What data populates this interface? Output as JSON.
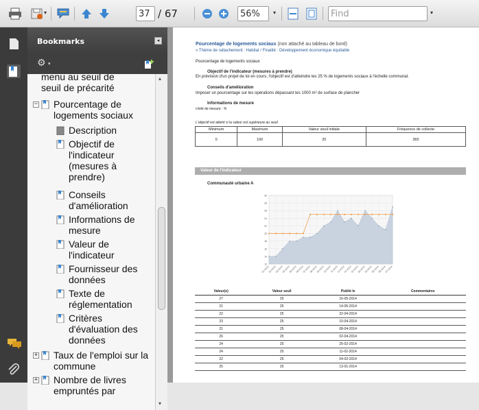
{
  "toolbar": {
    "page_current": "37",
    "page_total": "/ 67",
    "zoom": "56%",
    "find_placeholder": "Find"
  },
  "bookmarks_panel": {
    "title": "Bookmarks",
    "items": [
      {
        "label": "seuil de précarité"
      },
      {
        "label": "Pourcentage de logements sociaux"
      },
      {
        "label": "Description"
      },
      {
        "label": "Objectif de l'indicateur (mesures à prendre)"
      },
      {
        "label": "Conseils d'amélioration"
      },
      {
        "label": "Informations de mesure"
      },
      {
        "label": "Valeur de l'indicateur"
      },
      {
        "label": "Fournisseur des données"
      },
      {
        "label": "Texte de réglementation"
      },
      {
        "label": "Critères d'évaluation des données"
      },
      {
        "label": "Taux de l'emploi sur la commune"
      },
      {
        "label": "Nombre de livres empruntés par"
      }
    ]
  },
  "document": {
    "title": "Pourcentage de logements sociaux",
    "title_suffix": "(non attaché au tableau de bord)",
    "theme_line": "» Thème de rattachement : Habitat / Finalité : Développement économique équitable",
    "description": "Pourcentage de logements sociaux",
    "objective_heading": "Objectif de l'indicateur (mesures à prendre)",
    "objective_text": "En prévision d'un projet de loi en cours, l'objectif est d'atteindre les 25 % de logements sociaux à l'échelle communal.",
    "advice_heading": "Conseils d'amélioration",
    "advice_text": "Imposer un pourcentage sur les opérations dépassant les 1000 m² de surface de plancher",
    "info_heading": "Informations de mesure",
    "unit_text": "Unité de mesure : %",
    "threshold_note": "L'objectif est atteint si la valeur est supérieure au seuil.",
    "mm_headers": [
      "Minimum",
      "Maximum",
      "Valeur seuil initiale",
      "Fréquence de collecte"
    ],
    "mm_values": [
      "0",
      "100",
      "20",
      "365"
    ],
    "value_banner": "Valeur de l'indicateur",
    "chart_caption": "Communauté urbaine A",
    "values_headers": [
      "Valeur(s)",
      "Valeur seuil",
      "Publié le",
      "Commentaires"
    ],
    "values_rows": [
      [
        "27",
        "25",
        "16-05-2014",
        ""
      ],
      [
        "21",
        "25",
        "14-05-2014",
        ""
      ],
      [
        "22",
        "25",
        "22-04-2014",
        ""
      ],
      [
        "23",
        "25",
        "10-04-2014",
        ""
      ],
      [
        "21",
        "25",
        "08-04-2014",
        ""
      ],
      [
        "26",
        "25",
        "02-04-2014",
        ""
      ],
      [
        "24",
        "25",
        "25-02-2014",
        ""
      ],
      [
        "24",
        "25",
        "11-02-2014",
        ""
      ],
      [
        "22",
        "25",
        "04-02-2014",
        ""
      ],
      [
        "25",
        "25",
        "13-01-2014",
        ""
      ]
    ]
  },
  "chart_data": {
    "type": "area",
    "title": "",
    "xlabel": "",
    "ylabel": "",
    "ylim": [
      12,
      30
    ],
    "x": [
      "01-2013",
      "02-2013",
      "03-2013",
      "04-2013",
      "05-2013",
      "06-2013",
      "07-2013",
      "08-2013",
      "09-2013",
      "10-2013",
      "11-2013",
      "12-2013",
      "01-2014",
      "02-2014",
      "03-2014",
      "04-2014",
      "05-2014",
      "06-2014",
      "07-2014"
    ],
    "series": [
      {
        "values": [
          14,
          14,
          16,
          18,
          18,
          19,
          19,
          20,
          22,
          23,
          26,
          23,
          24,
          22,
          26,
          24,
          22,
          21,
          27
        ]
      },
      {
        "values": [
          20,
          20,
          20,
          20,
          20,
          20,
          25,
          25,
          25,
          25,
          25,
          25,
          25,
          25,
          25,
          25,
          25,
          25,
          25
        ]
      }
    ],
    "grid": true
  }
}
